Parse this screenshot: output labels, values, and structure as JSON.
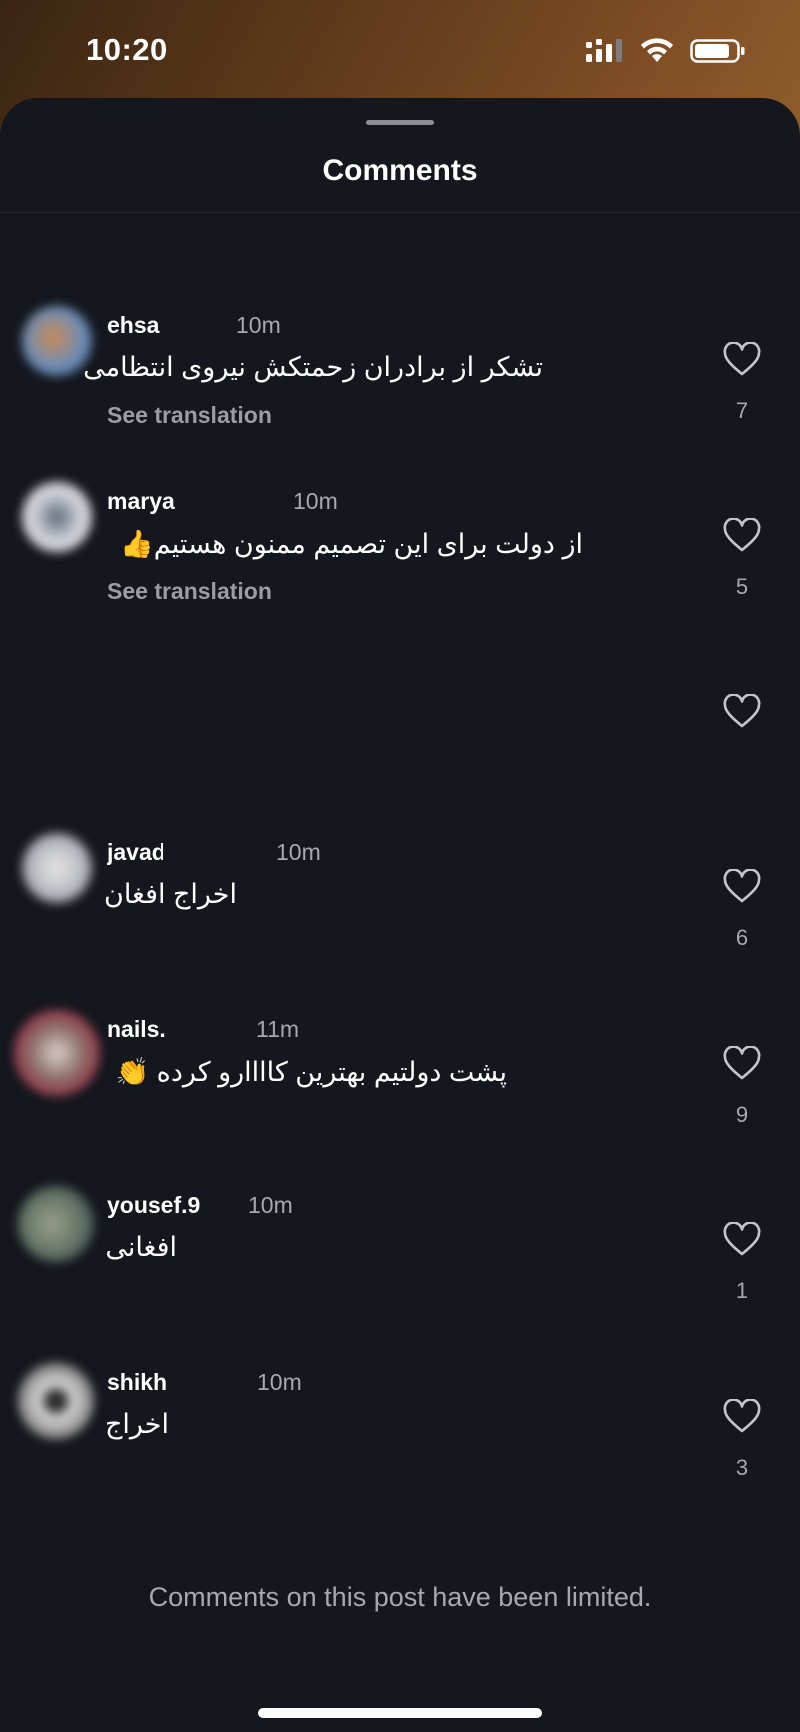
{
  "status_bar": {
    "time": "10:20",
    "icons": [
      "signal-icon",
      "wifi-icon",
      "battery-icon"
    ]
  },
  "sheet": {
    "title": "Comments"
  },
  "comments": [
    {
      "username": "ehsa",
      "time": "10m",
      "text": "تشکر از برادران زحمتکش نیروی انتظامی",
      "translation": "See translation",
      "likes": "7"
    },
    {
      "username": "marya",
      "time": "10m",
      "text": "از دولت برای این تصمیم ممنون هستیم👍",
      "translation": "See translation",
      "likes": "5"
    },
    {
      "username": "",
      "time": "",
      "text": "",
      "translation": "",
      "likes": ""
    },
    {
      "username": "javad",
      "time": "10m",
      "text": "اخراج افغان",
      "translation": "",
      "likes": "6"
    },
    {
      "username": "nails.",
      "time": "11m",
      "text": "پشت دولتیم بهترین کاااارو کرده 👏",
      "translation": "",
      "likes": "9"
    },
    {
      "username": "yousef.9",
      "time": "10m",
      "text": "افغانی",
      "translation": "",
      "likes": "1"
    },
    {
      "username": "shikh",
      "time": "10m",
      "text": "اخراج",
      "translation": "",
      "likes": "3"
    }
  ],
  "footer": {
    "note": "Comments on this post have been limited."
  },
  "colors": {
    "sheet_background": "#14171d",
    "primary_text": "#ffffff",
    "secondary_text": "#a6a9b0"
  }
}
